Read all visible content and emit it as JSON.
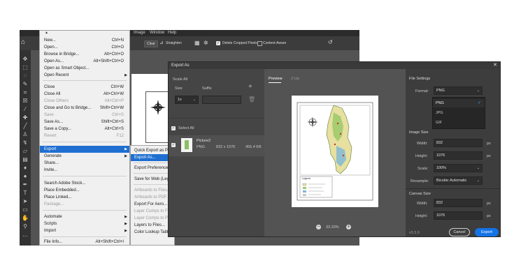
{
  "photoshop": {
    "menubar_items": [
      "Image",
      "Window",
      "Help"
    ],
    "options_bar": {
      "clear": "Clear",
      "straighten": "Straighten",
      "delete_cropped": "Delete Cropped Pixels",
      "content_aware": "Content-Aware"
    }
  },
  "file_menu": {
    "items": [
      {
        "label": "New...",
        "shortcut": "Ctrl+N"
      },
      {
        "label": "Open...",
        "shortcut": "Ctrl+O"
      },
      {
        "label": "Browse in Bridge...",
        "shortcut": "Alt+Ctrl+O"
      },
      {
        "label": "Open As...",
        "shortcut": "Alt+Shift+Ctrl+O"
      },
      {
        "label": "Open as Smart Object...",
        "shortcut": ""
      },
      {
        "label": "Open Recent",
        "shortcut": ""
      },
      {
        "label": "Close",
        "shortcut": "Ctrl+W"
      },
      {
        "label": "Close All",
        "shortcut": "Alt+Ctrl+W"
      },
      {
        "label": "Close Others",
        "shortcut": "Alt+Ctrl+P"
      },
      {
        "label": "Close and Go to Bridge...",
        "shortcut": "Shift+Ctrl+W"
      },
      {
        "label": "Save",
        "shortcut": "Ctrl+S"
      },
      {
        "label": "Save As...",
        "shortcut": "Shift+Ctrl+S"
      },
      {
        "label": "Save a Copy...",
        "shortcut": "Alt+Ctrl+S"
      },
      {
        "label": "Revert",
        "shortcut": "F12"
      },
      {
        "label": "Export",
        "shortcut": ""
      },
      {
        "label": "Generate",
        "shortcut": ""
      },
      {
        "label": "Share...",
        "shortcut": ""
      },
      {
        "label": "Invite...",
        "shortcut": ""
      },
      {
        "label": "Search Adobe Stock...",
        "shortcut": ""
      },
      {
        "label": "Place Embedded...",
        "shortcut": ""
      },
      {
        "label": "Place Linked...",
        "shortcut": ""
      },
      {
        "label": "Package...",
        "shortcut": ""
      },
      {
        "label": "Automate",
        "shortcut": ""
      },
      {
        "label": "Scripts",
        "shortcut": ""
      },
      {
        "label": "Import",
        "shortcut": ""
      },
      {
        "label": "File Info...",
        "shortcut": "Alt+Shift+Ctrl+I"
      }
    ]
  },
  "export_menu": {
    "items": [
      {
        "label": "Quick Export as PNG"
      },
      {
        "label": "Export As..."
      },
      {
        "label": "Export Preferences..."
      },
      {
        "label": "Save for Web (Legacy)..."
      },
      {
        "label": "Artboards to Files..."
      },
      {
        "label": "Artboards to PDF..."
      },
      {
        "label": "Export For Aero..."
      },
      {
        "label": "Layer Comps to Files..."
      },
      {
        "label": "Layer Comps to PDF..."
      },
      {
        "label": "Layers to Files..."
      },
      {
        "label": "Color Lookup Tables..."
      }
    ]
  },
  "export_dialog": {
    "title": "Export As",
    "scale_all": "Scale All",
    "size_label": "Size",
    "suffix_label": "Suffix",
    "size_value": "1x",
    "select_all": "Select All",
    "asset": {
      "name": "Picture2",
      "format": "PNG",
      "dimensions": "832 x 1076",
      "filesize": "455.4 KB"
    },
    "tabs": [
      "Preview",
      "2-Up"
    ],
    "zoom": "33.33%",
    "file_settings": "File Settings",
    "format_label": "Format:",
    "format_value": "PNG",
    "format_options": [
      "PNG",
      "JPG",
      "GIF"
    ],
    "image_size": "Image Size",
    "width_label": "Width:",
    "width_value": "832",
    "height_label": "Height:",
    "height_value": "1076",
    "scale_label": "Scale:",
    "scale_value": "100%",
    "resample_label": "Resample:",
    "resample_value": "Bicubic Automatic",
    "canvas_size": "Canvas Size",
    "canvas_width": "832",
    "canvas_height": "1076",
    "unit": "px",
    "version": "v5.5.9",
    "cancel": "Cancel",
    "export": "Export",
    "legend_title": "Legend"
  }
}
